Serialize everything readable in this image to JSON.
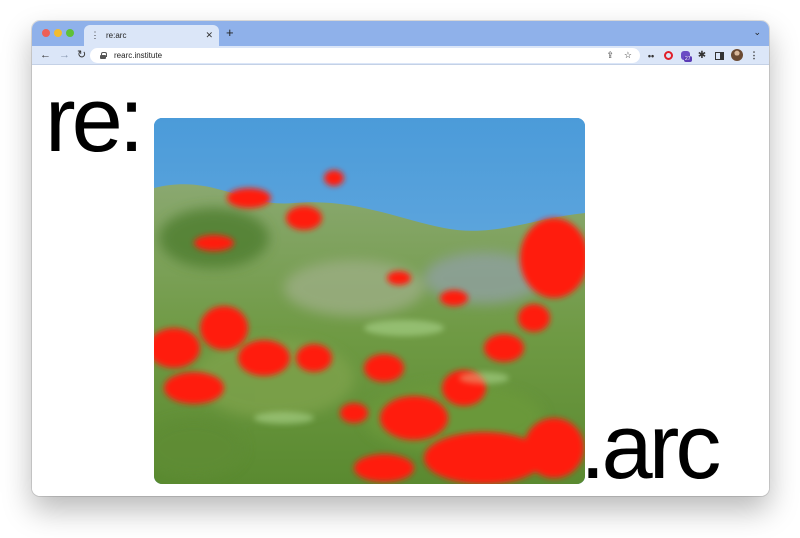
{
  "browser": {
    "tab": {
      "favicon": "⋮",
      "title": "re:arc",
      "close_icon": "✕"
    },
    "new_tab_icon": "+",
    "tab_search_icon": "⌄",
    "nav": {
      "back_icon": "←",
      "forward_icon": "→",
      "reload_icon": "↻"
    },
    "omnibox": {
      "url": "rearc.institute",
      "share_icon": "⇪",
      "bookmark_icon": "☆"
    },
    "extensions": {
      "dots_icon": "••",
      "badge": "27",
      "puzzle_icon": "✱",
      "menu_icon": "⋮"
    }
  },
  "page": {
    "logo_left": "re:",
    "logo_right": ".arc",
    "hero_image": "poppy-field-painting",
    "colors": {
      "sky": "#4a9ad8",
      "grass": "#6a9a40",
      "poppy": "#ff1a0a"
    }
  }
}
